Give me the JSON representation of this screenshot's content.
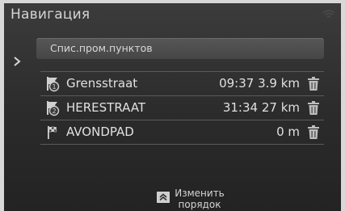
{
  "screen": {
    "title": "Навигация"
  },
  "header": {
    "label": "Спис.пром.пунктов"
  },
  "waypoints": [
    {
      "name": "Grensstraat",
      "info": "09:37 3.9 km",
      "icon": "waypoint-1-icon"
    },
    {
      "name": "HERESTRAAT",
      "info": "31:34 27 km",
      "icon": "waypoint-2-icon"
    },
    {
      "name": "AVONDPAD",
      "info": "0 m",
      "icon": "destination-flag-icon"
    }
  ],
  "bottom_button": {
    "line1": "Изменить",
    "line2": "порядок"
  },
  "colors": {
    "background": "#2b2b2b",
    "text": "#e0e0e0",
    "divider": "#5a5a5a",
    "header_bar": "#4d4d4d"
  }
}
